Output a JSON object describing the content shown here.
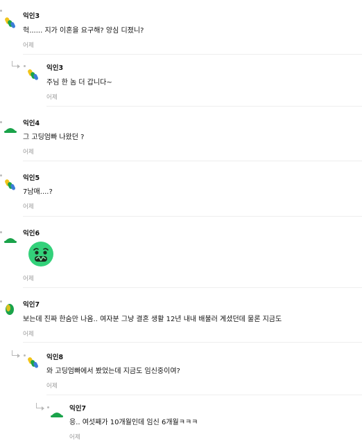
{
  "comments": [
    {
      "name": "익인3",
      "text": "헉...... 지가 이혼을 요구해? 양심 디졌니?",
      "time": "어제"
    },
    {
      "name": "익인3",
      "text": "주님 한 놈 더 갑니다~",
      "time": "어제"
    },
    {
      "name": "익인4",
      "text": "그 고딩엄빠 나왔던 ?",
      "time": "어제"
    },
    {
      "name": "익인5",
      "text": "7남매....?",
      "time": "어제"
    },
    {
      "name": "익인6",
      "text": "",
      "time": "어제"
    },
    {
      "name": "익인7",
      "text": "보는데 진짜 한숨만 나옴.. 여자분 그냥 결혼 생활 12년 내내 배불러 계셨던데 물론 지금도",
      "time": "어제"
    },
    {
      "name": "익인8",
      "text": "와 고딩엄빠에서 봤었는데 지금도 임신중이여?",
      "time": "어제"
    },
    {
      "name": "익인7",
      "text": "응.. 여섯째가 10개월인데 임신 6개월ㅋㅋㅋ",
      "time": "어제"
    }
  ],
  "colors": {
    "green": "#1aa34a",
    "yellow": "#f0c419",
    "blue": "#3b7dd8",
    "emoji": "#33d17a"
  }
}
